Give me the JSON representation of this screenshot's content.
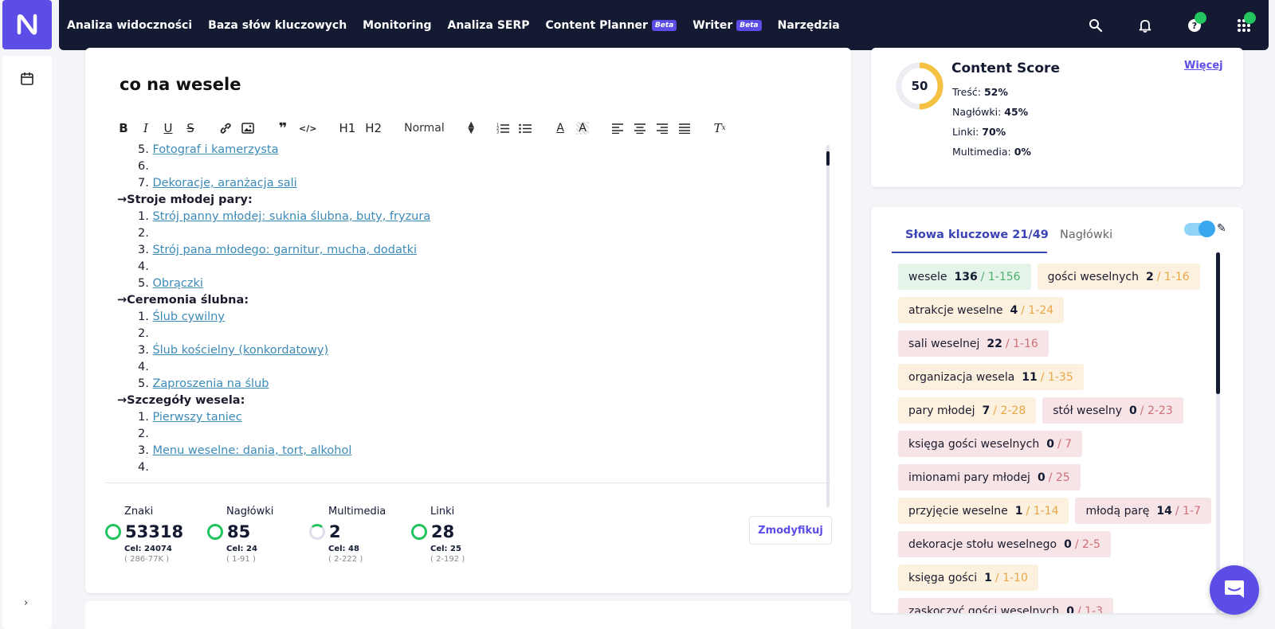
{
  "nav": {
    "items": [
      {
        "label": "Analiza widoczności"
      },
      {
        "label": "Baza słów kluczowych"
      },
      {
        "label": "Monitoring"
      },
      {
        "label": "Analiza SERP"
      },
      {
        "label": "Content Planner",
        "badge": "Beta"
      },
      {
        "label": "Writer",
        "badge": "Beta"
      },
      {
        "label": "Narzędzia"
      }
    ],
    "icons": [
      "search-icon",
      "bell-icon",
      "help-icon",
      "apps-grid-icon"
    ]
  },
  "editor": {
    "title": "co na wesele",
    "toolbar": {
      "format_select": "Normal",
      "h1": "H1",
      "h2": "H2"
    },
    "lines": [
      {
        "type": "li",
        "num": "5.",
        "text": "Fotograf i kamerzysta",
        "link": true
      },
      {
        "type": "li",
        "num": "6.",
        "text": "",
        "link": false
      },
      {
        "type": "li",
        "num": "7.",
        "text": "Dekoracje, aranżacja sali",
        "link": true
      },
      {
        "type": "h",
        "text": "Stroje młodej pary:"
      },
      {
        "type": "li",
        "num": "1.",
        "text": "Strój panny młodej: suknia ślubna, buty, fryzura",
        "link": true
      },
      {
        "type": "li",
        "num": "2.",
        "text": "",
        "link": false
      },
      {
        "type": "li",
        "num": "3.",
        "text": "Strój pana młodego: garnitur, mucha, dodatki",
        "link": true
      },
      {
        "type": "li",
        "num": "4.",
        "text": "",
        "link": false
      },
      {
        "type": "li",
        "num": "5.",
        "text": "Obrączki",
        "link": true
      },
      {
        "type": "h",
        "text": "Ceremonia ślubna:"
      },
      {
        "type": "li",
        "num": "1.",
        "text": "Ślub cywilny",
        "link": true
      },
      {
        "type": "li",
        "num": "2.",
        "text": "",
        "link": false
      },
      {
        "type": "li",
        "num": "3.",
        "text": "Ślub kościelny (konkordatowy)",
        "link": true
      },
      {
        "type": "li",
        "num": "4.",
        "text": "",
        "link": false
      },
      {
        "type": "li",
        "num": "5.",
        "text": "Zaproszenia na ślub",
        "link": true
      },
      {
        "type": "h",
        "text": "Szczegóły wesela:"
      },
      {
        "type": "li",
        "num": "1.",
        "text": "Pierwszy taniec",
        "link": true
      },
      {
        "type": "li",
        "num": "2.",
        "text": "",
        "link": false
      },
      {
        "type": "li",
        "num": "3.",
        "text": "Menu weselne: dania, tort, alkohol",
        "link": true
      },
      {
        "type": "li",
        "num": "4.",
        "text": "",
        "link": false
      }
    ],
    "arrow": "→",
    "stats": [
      {
        "label": "Znaki",
        "value": "53318",
        "target": "Cel: 24074",
        "range": "( 286-77K )",
        "complete": true
      },
      {
        "label": "Nagłówki",
        "value": "85",
        "target": "Cel: 24",
        "range": "( 1-91 )",
        "complete": true
      },
      {
        "label": "Multimedia",
        "value": "2",
        "target": "Cel: 48",
        "range": "( 2-222 )",
        "complete": false
      },
      {
        "label": "Linki",
        "value": "28",
        "target": "Cel: 25",
        "range": "( 2-192 )",
        "complete": true
      }
    ],
    "modify_button": "Zmodyfikuj"
  },
  "score": {
    "value": "50",
    "percent": 50,
    "title": "Content Score",
    "more_link": "Więcej",
    "rows": [
      {
        "label": "Treść:",
        "value": "52%"
      },
      {
        "label": "Nagłówki:",
        "value": "45%"
      },
      {
        "label": "Linki:",
        "value": "70%"
      },
      {
        "label": "Multimedia:",
        "value": "0%"
      }
    ]
  },
  "keywords": {
    "tab_active": "Słowa kluczowe 21/49",
    "tab_inactive": "Nagłówki",
    "toggle_on": true,
    "rows": [
      [
        {
          "text": "wesele",
          "count": "136",
          "range": "/ 1-156",
          "status": "green"
        },
        {
          "text": "gości weselnych",
          "count": "2",
          "range": "/ 1-16",
          "status": "yellow"
        }
      ],
      [
        {
          "text": "atrakcje weselne",
          "count": "4",
          "range": "/ 1-24",
          "status": "yellow"
        }
      ],
      [
        {
          "text": "sali weselnej",
          "count": "22",
          "range": "/ 1-16",
          "status": "red"
        }
      ],
      [
        {
          "text": "organizacja wesela",
          "count": "11",
          "range": "/ 1-35",
          "status": "yellow"
        }
      ],
      [
        {
          "text": "pary młodej",
          "count": "7",
          "range": "/ 2-28",
          "status": "yellow"
        },
        {
          "text": "stół weselny",
          "count": "0",
          "range": "/ 2-23",
          "status": "red"
        }
      ],
      [
        {
          "text": "księga gości weselnych",
          "count": "0",
          "range": "/ 7",
          "status": "red"
        }
      ],
      [
        {
          "text": "imionami pary młodej",
          "count": "0",
          "range": "/ 25",
          "status": "red"
        }
      ],
      [
        {
          "text": "przyjęcie weselne",
          "count": "1",
          "range": "/ 1-14",
          "status": "yellow"
        },
        {
          "text": "młodą parę",
          "count": "14",
          "range": "/ 1-7",
          "status": "red"
        }
      ],
      [
        {
          "text": "dekoracje stołu weselnego",
          "count": "0",
          "range": "/ 2-5",
          "status": "red"
        }
      ],
      [
        {
          "text": "księga gości",
          "count": "1",
          "range": "/ 1-10",
          "status": "yellow"
        }
      ],
      [
        {
          "text": "zaskoczyć gości weselnych",
          "count": "0",
          "range": "/ 1-3",
          "status": "red"
        }
      ]
    ]
  },
  "colors": {
    "brand": "#5b4de6",
    "nav_bg": "#131a32",
    "score_ring": "#f5c142",
    "ok": "#22c55e"
  }
}
